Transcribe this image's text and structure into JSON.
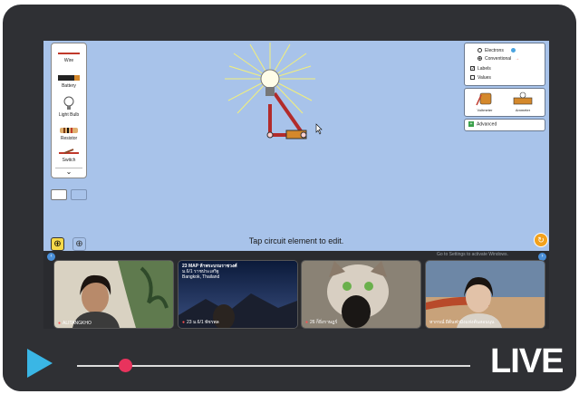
{
  "sim": {
    "toolbox": [
      {
        "label": "Wire",
        "icon": "wire-icon"
      },
      {
        "label": "Battery",
        "icon": "battery-icon"
      },
      {
        "label": "Light Bulb",
        "icon": "light-bulb-icon"
      },
      {
        "label": "Resistor",
        "icon": "resistor-icon"
      },
      {
        "label": "Switch",
        "icon": "switch-icon"
      }
    ],
    "options": {
      "electrons": "Electrons",
      "conventional": "Conventional",
      "labels": "Labels",
      "values": "Values",
      "current_mode": "Conventional",
      "labels_checked": true,
      "values_checked": false
    },
    "meters": {
      "voltmeter": "Voltmeter",
      "ammeter": "Ammeter"
    },
    "advanced": "Advanced",
    "status": "Tap circuit element to edit.",
    "zoom_out_icon": "zoom-out-icon",
    "zoom_in_icon": "zoom-in-icon",
    "reset_icon": "reset-icon"
  },
  "meeting": {
    "windows_notice": "Go to Settings to activate Windows.",
    "participants": [
      {
        "name": "ALITANGKHO"
      },
      {
        "name": "23 ม.6/1 พัชรพล"
      },
      {
        "name": "26 ก็ยิ่งราษฎร์"
      },
      {
        "name": "หากรณ์ ผีต้นฟามิงแห่งต้นสอนนุน"
      }
    ],
    "tile2_caption": {
      "title": "23 MAP ห้าพระบรมราชวงศ์",
      "sub1": "ม.6/1 ราชประเสริฐ",
      "sub2": "Bangkok, Thailand"
    }
  },
  "player": {
    "live": "LIVE",
    "progress": 0.12,
    "accent": "#e8335d",
    "play_color": "#3ab6e5"
  },
  "colors": {
    "sim_bg": "#a8c3ea",
    "frame": "#2f3034",
    "advanced_badge": "#3aa04a"
  }
}
